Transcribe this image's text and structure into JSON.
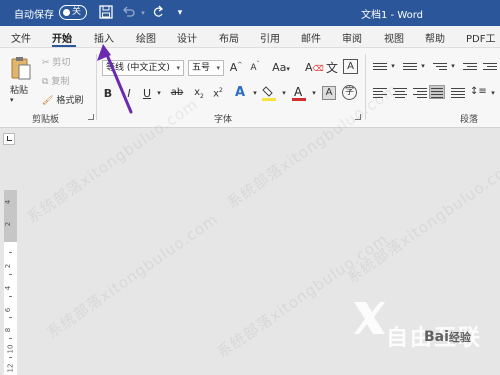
{
  "titlebar": {
    "autosave_label": "自动保存",
    "toggle_state": "关",
    "doc_title": "文档1 - Word"
  },
  "tabs": [
    "文件",
    "开始",
    "插入",
    "绘图",
    "设计",
    "布局",
    "引用",
    "邮件",
    "审阅",
    "视图",
    "帮助",
    "PDF工具"
  ],
  "active_tab": "开始",
  "clipboard": {
    "paste_label": "粘贴",
    "cut_label": "剪切",
    "copy_label": "复制",
    "format_painter_label": "格式刷",
    "group_label": "剪贴板"
  },
  "font": {
    "font_name": "等线 (中文正文)",
    "font_size": "五号",
    "group_label": "字体"
  },
  "paragraph": {
    "group_label": "段落"
  },
  "ruler_numbers": [
    "4",
    "2",
    "2",
    "4",
    "6",
    "8",
    "10",
    "12"
  ],
  "watermark": {
    "text": "系统部落xitongbuluo.com",
    "logo_text": "自由互联",
    "baidu_text": "Bai",
    "baidu_tail": "经验"
  },
  "colors": {
    "titlebar": "#2b579a",
    "ribbon": "#f7f7f7",
    "canvas": "#e6e6e6",
    "arrow": "#6a2bb0",
    "font_color": "#d32f2f",
    "highlight": "#f5e43b"
  }
}
